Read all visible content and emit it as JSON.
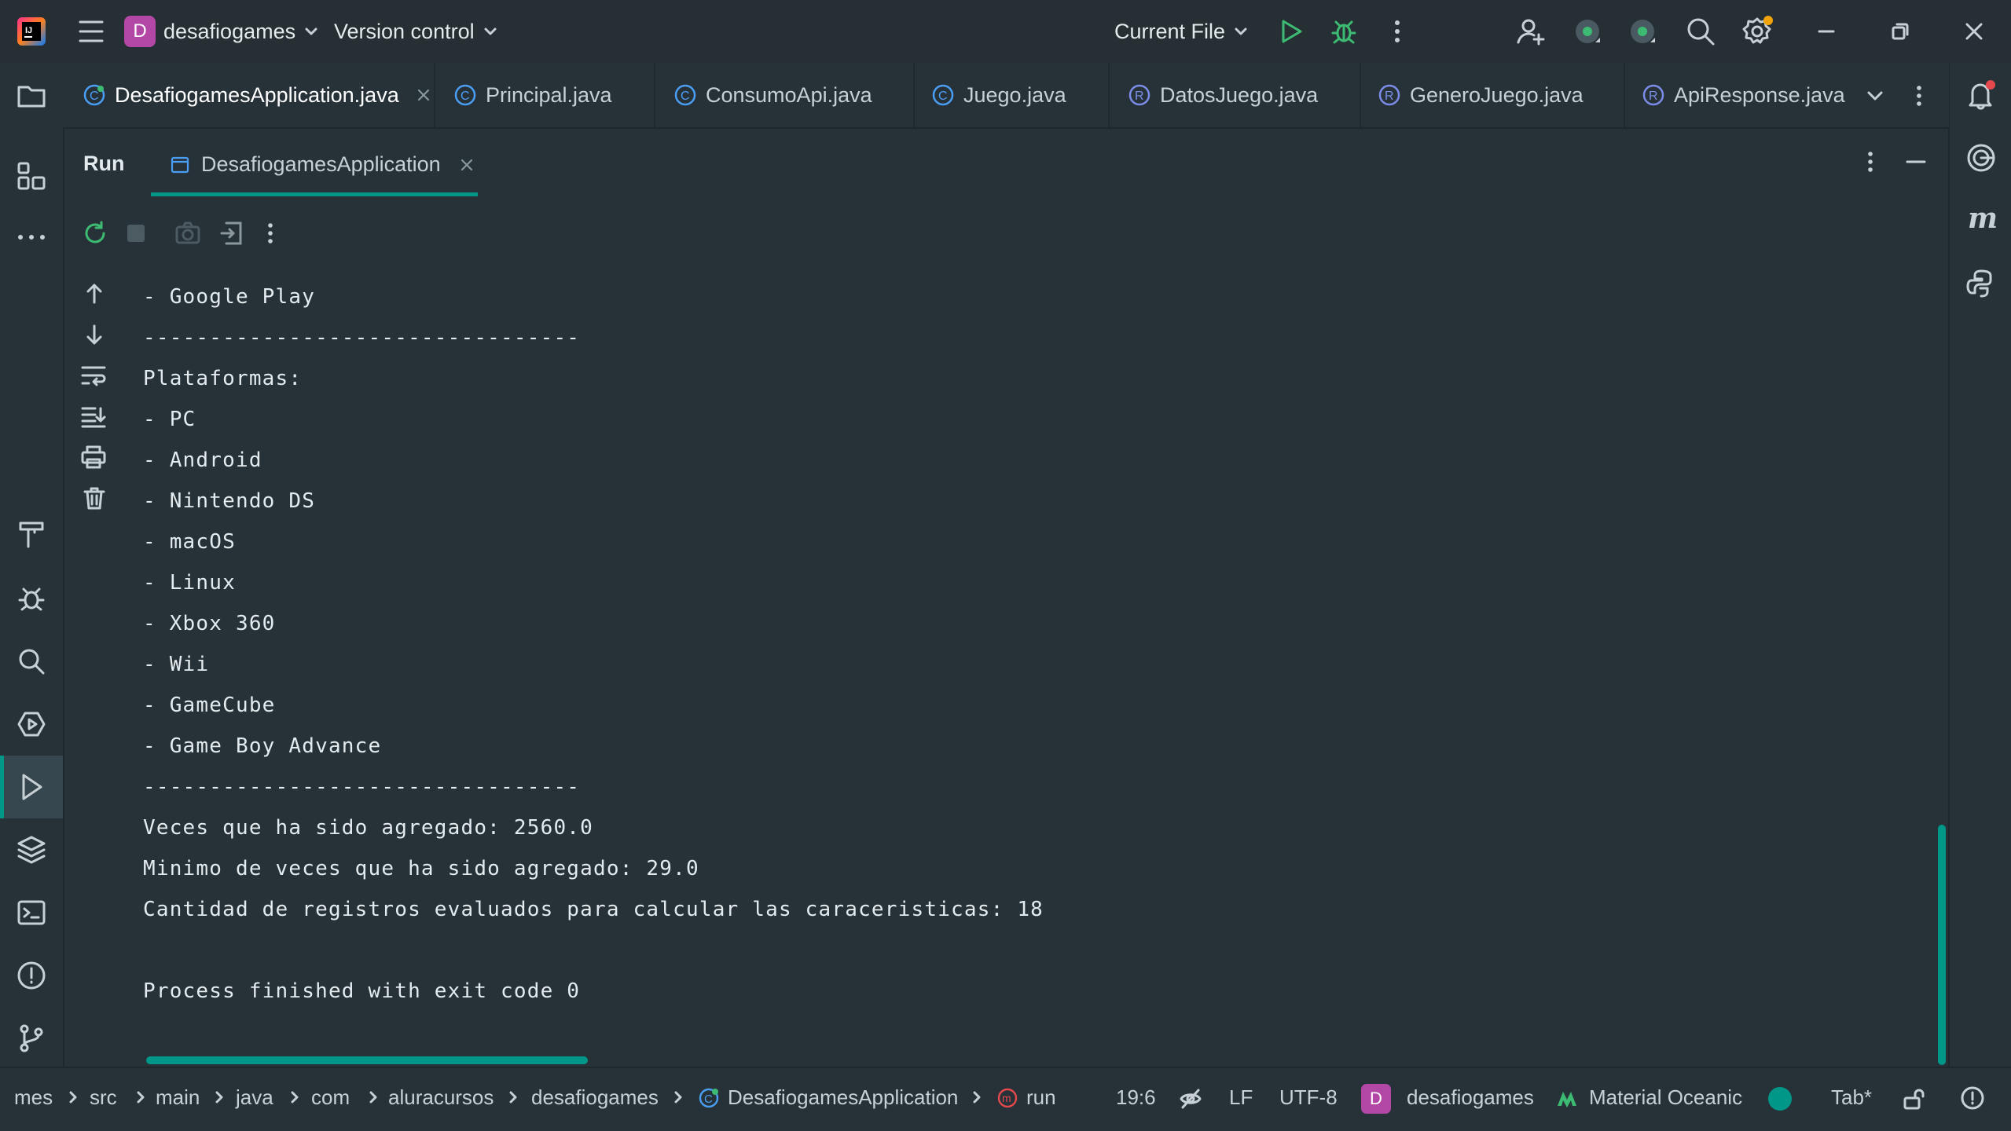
{
  "titlebar": {
    "project_initial": "D",
    "project_name": "desafiogames",
    "version_control": "Version control",
    "run_config": "Current File"
  },
  "tabs": [
    {
      "label": "DesafiogamesApplication.java",
      "icon": "spring-class-icon",
      "active": true
    },
    {
      "label": "Principal.java",
      "icon": "class-icon"
    },
    {
      "label": "ConsumoApi.java",
      "icon": "class-icon"
    },
    {
      "label": "Juego.java",
      "icon": "class-icon"
    },
    {
      "label": "DatosJuego.java",
      "icon": "record-icon"
    },
    {
      "label": "GeneroJuego.java",
      "icon": "record-icon"
    },
    {
      "label": "ApiResponse.java",
      "icon": "record-icon"
    }
  ],
  "run_panel": {
    "title": "Run",
    "tab_label": "DesafiogamesApplication"
  },
  "console": {
    "lines": [
      "- Google Play",
      "---------------------------------",
      "Plataformas:",
      "- PC",
      "- Android",
      "- Nintendo DS",
      "- macOS",
      "- Linux",
      "- Xbox 360",
      "- Wii",
      "- GameCube",
      "- Game Boy Advance",
      "---------------------------------",
      "Veces que ha sido agregado: 2560.0",
      "Minimo de veces que ha sido agregado: 29.0",
      "Cantidad de registros evaluados para calcular las caraceristicas: 18",
      "",
      "Process finished with exit code 0"
    ]
  },
  "statusbar": {
    "breadcrumbs": [
      "mes",
      "src",
      "main",
      "java",
      "com",
      "aluracursos",
      "desafiogames",
      "DesafiogamesApplication",
      "run"
    ],
    "position": "19:6",
    "line_ending": "LF",
    "encoding": "UTF-8",
    "project_initial": "D",
    "project": "desafiogames",
    "theme": "Material Oceanic",
    "indent": "Tab*"
  },
  "colors": {
    "background": "#263238",
    "accent": "#009688",
    "run_green": "#3dbb73",
    "project_badge": "#b347a6"
  }
}
